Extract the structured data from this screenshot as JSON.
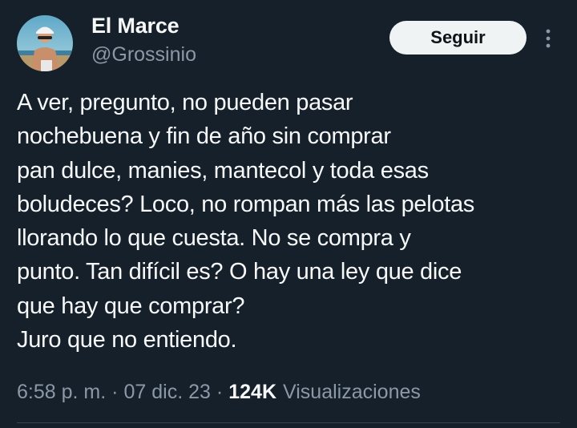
{
  "author": {
    "name": "El Marce",
    "handle": "@Grossinio"
  },
  "actions": {
    "follow_label": "Seguir",
    "more_icon": "more-vertical-icon"
  },
  "tweet": {
    "lines": [
      "A ver, pregunto, no pueden pasar",
      "nochebuena y fin de año sin comprar",
      "pan dulce, manies, mantecol y toda esas",
      "boludeces? Loco, no rompan más las pelotas",
      "llorando lo que cuesta. No se compra y",
      "punto. Tan difícil es? O hay una ley que dice",
      "que hay que comprar?",
      "Juro que no entiendo."
    ]
  },
  "meta": {
    "time": "6:58 p. m.",
    "separator": "·",
    "date": "07 dic. 23",
    "views_count": "124K",
    "views_label": "Visualizaciones"
  },
  "colors": {
    "background": "#15202b",
    "text_primary": "#f7f9f9",
    "text_secondary": "#8b98a5",
    "button_bg": "#eff3f4",
    "button_text": "#0f1419",
    "divider": "#38444d"
  }
}
